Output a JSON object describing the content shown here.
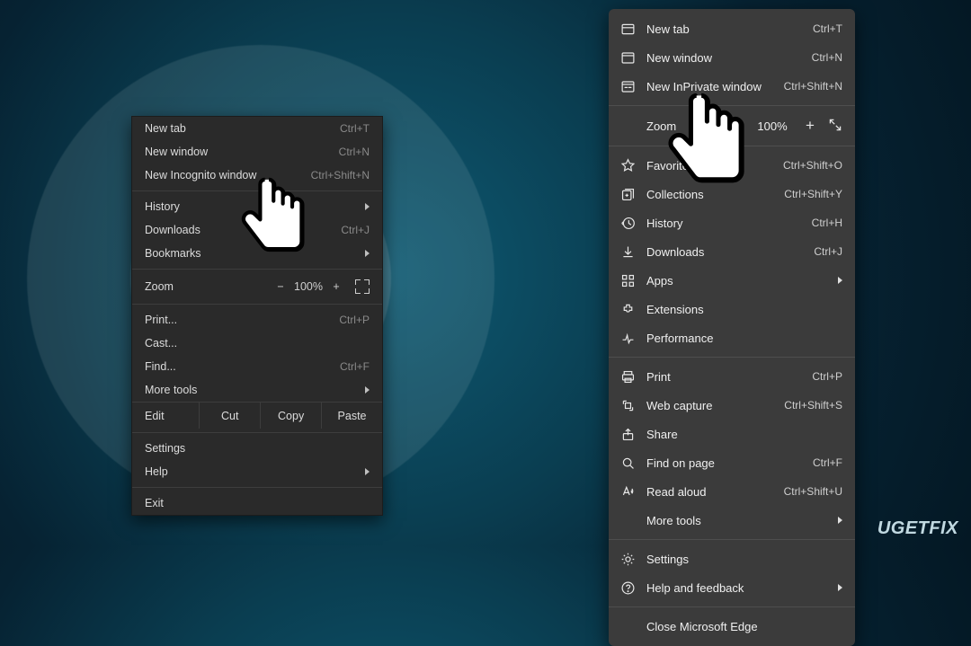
{
  "chrome": {
    "items": [
      {
        "label": "New tab",
        "shortcut": "Ctrl+T"
      },
      {
        "label": "New window",
        "shortcut": "Ctrl+N"
      },
      {
        "label": "New Incognito window",
        "shortcut": "Ctrl+Shift+N"
      }
    ],
    "history": {
      "label": "History"
    },
    "downloads": {
      "label": "Downloads",
      "shortcut": "Ctrl+J"
    },
    "bookmarks": {
      "label": "Bookmarks"
    },
    "zoom": {
      "label": "Zoom",
      "value": "100%"
    },
    "print": {
      "label": "Print...",
      "shortcut": "Ctrl+P"
    },
    "cast": {
      "label": "Cast..."
    },
    "find": {
      "label": "Find...",
      "shortcut": "Ctrl+F"
    },
    "moretools": {
      "label": "More tools"
    },
    "edit": {
      "label": "Edit",
      "cut": "Cut",
      "copy": "Copy",
      "paste": "Paste"
    },
    "settings": {
      "label": "Settings"
    },
    "help": {
      "label": "Help"
    },
    "exit": {
      "label": "Exit"
    }
  },
  "edge": {
    "newtab": {
      "label": "New tab",
      "shortcut": "Ctrl+T"
    },
    "newwin": {
      "label": "New window",
      "shortcut": "Ctrl+N"
    },
    "inprivate": {
      "label": "New InPrivate window",
      "shortcut": "Ctrl+Shift+N"
    },
    "zoom": {
      "label": "Zoom",
      "value": "100%"
    },
    "favorites": {
      "label": "Favorites",
      "shortcut": "Ctrl+Shift+O"
    },
    "collections": {
      "label": "Collections",
      "shortcut": "Ctrl+Shift+Y"
    },
    "history": {
      "label": "History",
      "shortcut": "Ctrl+H"
    },
    "downloads": {
      "label": "Downloads",
      "shortcut": "Ctrl+J"
    },
    "apps": {
      "label": "Apps"
    },
    "extensions": {
      "label": "Extensions"
    },
    "performance": {
      "label": "Performance"
    },
    "print": {
      "label": "Print",
      "shortcut": "Ctrl+P"
    },
    "webcapture": {
      "label": "Web capture",
      "shortcut": "Ctrl+Shift+S"
    },
    "share": {
      "label": "Share"
    },
    "find": {
      "label": "Find on page",
      "shortcut": "Ctrl+F"
    },
    "readaloud": {
      "label": "Read aloud",
      "shortcut": "Ctrl+Shift+U"
    },
    "moretools": {
      "label": "More tools"
    },
    "settings": {
      "label": "Settings"
    },
    "help": {
      "label": "Help and feedback"
    },
    "close": {
      "label": "Close Microsoft Edge"
    }
  },
  "watermark": "UGETFIX"
}
